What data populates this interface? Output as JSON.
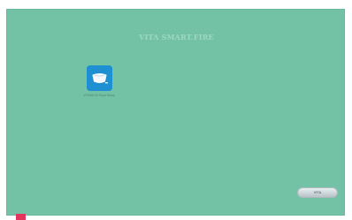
{
  "screen": {
    "title": "VITA SMART.FIRE",
    "background_color": "#73c2a6"
  },
  "app": {
    "icon": "basket-icon",
    "label": "VITADECK Boot Setup"
  },
  "vita_button": {
    "label": "VITA"
  },
  "corner_mark": {
    "color": "#e3345e"
  }
}
